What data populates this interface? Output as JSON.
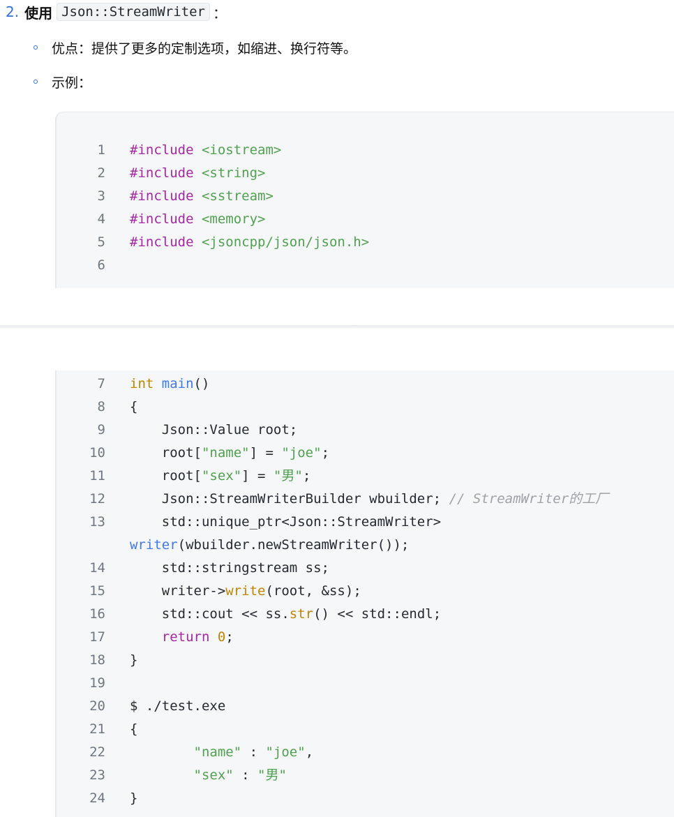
{
  "heading": {
    "number": "2.",
    "label": "使用",
    "code": "Json::StreamWriter",
    "colon": "："
  },
  "bullets": [
    {
      "text": "优点：提供了更多的定制选项，如缩进、换行符等。"
    },
    {
      "text": "示例："
    }
  ],
  "code": {
    "lines": [
      {
        "n": "1",
        "parts": [
          {
            "t": "#include ",
            "c": "kw"
          },
          {
            "t": "<iostream>",
            "c": "str"
          }
        ]
      },
      {
        "n": "2",
        "parts": [
          {
            "t": "#include ",
            "c": "kw"
          },
          {
            "t": "<string>",
            "c": "str"
          }
        ]
      },
      {
        "n": "3",
        "parts": [
          {
            "t": "#include ",
            "c": "kw"
          },
          {
            "t": "<sstream>",
            "c": "str"
          }
        ]
      },
      {
        "n": "4",
        "parts": [
          {
            "t": "#include ",
            "c": "kw"
          },
          {
            "t": "<memory>",
            "c": "str"
          }
        ]
      },
      {
        "n": "5",
        "parts": [
          {
            "t": "#include ",
            "c": "kw"
          },
          {
            "t": "<jsoncpp/json/json.h>",
            "c": "str"
          }
        ]
      },
      {
        "n": "6",
        "parts": []
      },
      {
        "n": "7",
        "parts": [
          {
            "t": "int",
            "c": "ty"
          },
          {
            "t": " "
          },
          {
            "t": "main",
            "c": "fn"
          },
          {
            "t": "()"
          }
        ]
      },
      {
        "n": "8",
        "parts": [
          {
            "t": "{"
          }
        ]
      },
      {
        "n": "9",
        "parts": [
          {
            "t": "    Json::Value root;"
          }
        ]
      },
      {
        "n": "10",
        "parts": [
          {
            "t": "    root["
          },
          {
            "t": "\"name\"",
            "c": "str"
          },
          {
            "t": "] = "
          },
          {
            "t": "\"joe\"",
            "c": "str"
          },
          {
            "t": ";"
          }
        ]
      },
      {
        "n": "11",
        "parts": [
          {
            "t": "    root["
          },
          {
            "t": "\"sex\"",
            "c": "str"
          },
          {
            "t": "] = "
          },
          {
            "t": "\"男\"",
            "c": "str"
          },
          {
            "t": ";"
          }
        ]
      },
      {
        "n": "12",
        "parts": [
          {
            "t": "    Json::StreamWriterBuilder wbuilder; "
          },
          {
            "t": "// StreamWriter的工厂",
            "c": "cm"
          }
        ]
      },
      {
        "n": "13",
        "parts": [
          {
            "t": "    std::unique_ptr<Json::StreamWriter>"
          }
        ]
      },
      {
        "n": "",
        "parts": [
          {
            "t": "writer",
            "c": "fn"
          },
          {
            "t": "(wbuilder.newStreamWriter());"
          }
        ]
      },
      {
        "n": "14",
        "parts": [
          {
            "t": "    std::stringstream ss;"
          }
        ]
      },
      {
        "n": "15",
        "parts": [
          {
            "t": "    writer->"
          },
          {
            "t": "write",
            "c": "ty"
          },
          {
            "t": "(root, &ss);"
          }
        ]
      },
      {
        "n": "16",
        "parts": [
          {
            "t": "    std::cout << ss."
          },
          {
            "t": "str",
            "c": "ty"
          },
          {
            "t": "() << std::endl;"
          }
        ]
      },
      {
        "n": "17",
        "parts": [
          {
            "t": "    "
          },
          {
            "t": "return",
            "c": "kw"
          },
          {
            "t": " "
          },
          {
            "t": "0",
            "c": "num0"
          },
          {
            "t": ";"
          }
        ]
      },
      {
        "n": "18",
        "parts": [
          {
            "t": "}"
          }
        ]
      },
      {
        "n": "19",
        "parts": []
      },
      {
        "n": "20",
        "parts": [
          {
            "t": "$ ./test.exe"
          }
        ]
      },
      {
        "n": "21",
        "parts": [
          {
            "t": "{"
          }
        ]
      },
      {
        "n": "22",
        "parts": [
          {
            "t": "        "
          },
          {
            "t": "\"name\"",
            "c": "str"
          },
          {
            "t": " : "
          },
          {
            "t": "\"joe\"",
            "c": "str"
          },
          {
            "t": ","
          }
        ]
      },
      {
        "n": "23",
        "parts": [
          {
            "t": "        "
          },
          {
            "t": "\"sex\"",
            "c": "str"
          },
          {
            "t": " : "
          },
          {
            "t": "\"男\"",
            "c": "str"
          }
        ]
      },
      {
        "n": "24",
        "parts": [
          {
            "t": "}"
          }
        ]
      }
    ]
  }
}
